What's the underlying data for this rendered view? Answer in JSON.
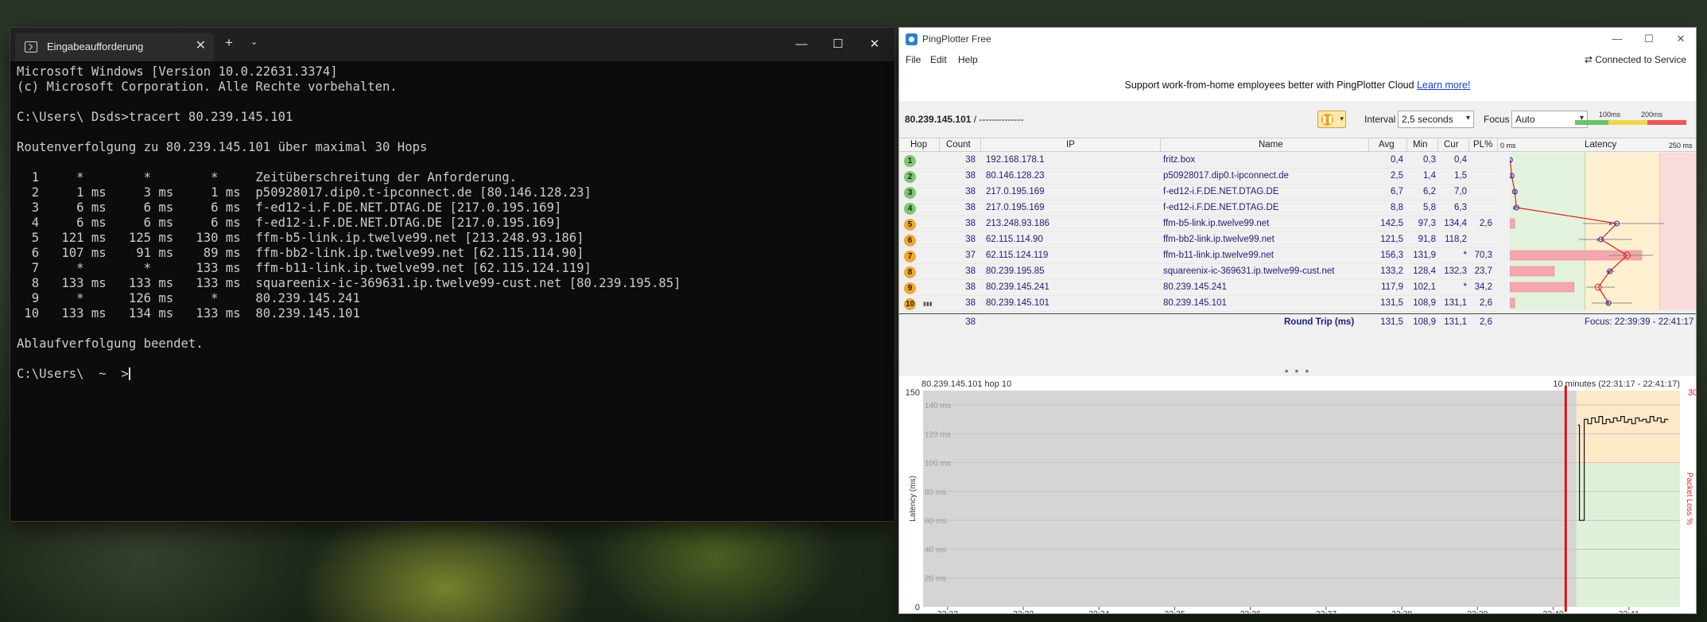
{
  "cmd": {
    "tab_title": "Eingabeaufforderung",
    "new_tab": "+",
    "lines": [
      "Microsoft Windows [Version 10.0.22631.3374]",
      "(c) Microsoft Corporation. Alle Rechte vorbehalten.",
      "",
      "C:\\Users\\ Dsds>tracert 80.239.145.101",
      "",
      "Routenverfolgung zu 80.239.145.101 über maximal 30 Hops",
      "",
      "  1     *        *        *     Zeitüberschreitung der Anforderung.",
      "  2     1 ms     3 ms     1 ms  p50928017.dip0.t-ipconnect.de [80.146.128.23]",
      "  3     6 ms     6 ms     6 ms  f-ed12-i.F.DE.NET.DTAG.DE [217.0.195.169]",
      "  4     6 ms     6 ms     6 ms  f-ed12-i.F.DE.NET.DTAG.DE [217.0.195.169]",
      "  5   121 ms   125 ms   130 ms  ffm-b5-link.ip.twelve99.net [213.248.93.186]",
      "  6   107 ms    91 ms    89 ms  ffm-bb2-link.ip.twelve99.net [62.115.114.90]",
      "  7     *        *      133 ms  ffm-b11-link.ip.twelve99.net [62.115.124.119]",
      "  8   133 ms   133 ms   133 ms  squareenix-ic-369631.ip.twelve99-cust.net [80.239.195.85]",
      "  9     *      126 ms     *     80.239.145.241",
      " 10   133 ms   134 ms   133 ms  80.239.145.101",
      "",
      "Ablaufverfolgung beendet.",
      "",
      "C:\\Users\\  ~  >"
    ]
  },
  "pingplotter": {
    "title": "PingPlotter Free",
    "menu": [
      "File",
      "Edit",
      "Help"
    ],
    "connection": "⇄ Connected to Service",
    "banner_text": "Support work-from-home employees better with PingPlotter Cloud",
    "banner_link": "Learn more!",
    "target": "80.239.145.101",
    "target_suffix": "/  --------------",
    "interval_label": "Interval",
    "interval_value": "2,5 seconds",
    "focus_label": "Focus",
    "focus_value": "Auto",
    "legend_100": "100ms",
    "legend_200": "200ms",
    "columns": {
      "hop": "Hop",
      "count": "Count",
      "ip": "IP",
      "name": "Name",
      "avg": "Avg",
      "min": "Min",
      "cur": "Cur",
      "pl": "PL%",
      "latency": "Latency",
      "scale_left": "0 ms",
      "scale_right": "250 ms"
    },
    "hops": [
      {
        "hop": "1",
        "count": "38",
        "ip": "192.168.178.1",
        "name": "fritz.box",
        "avg": "0,4",
        "min": "0,3",
        "cur": "0,4",
        "pl": "",
        "color": "#7cc870"
      },
      {
        "hop": "2",
        "count": "38",
        "ip": "80.146.128.23",
        "name": "p50928017.dip0.t-ipconnect.de",
        "avg": "2,5",
        "min": "1,4",
        "cur": "1,5",
        "pl": "",
        "color": "#7cc870"
      },
      {
        "hop": "3",
        "count": "38",
        "ip": "217.0.195.169",
        "name": "f-ed12-i.F.DE.NET.DTAG.DE",
        "avg": "6,7",
        "min": "6,2",
        "cur": "7,0",
        "pl": "",
        "color": "#7cc870"
      },
      {
        "hop": "4",
        "count": "38",
        "ip": "217.0.195.169",
        "name": "f-ed12-i.F.DE.NET.DTAG.DE",
        "avg": "8,8",
        "min": "5,8",
        "cur": "6,3",
        "pl": "",
        "color": "#7cc870"
      },
      {
        "hop": "5",
        "count": "38",
        "ip": "213.248.93.186",
        "name": "ffm-b5-link.ip.twelve99.net",
        "avg": "142,5",
        "min": "97,3",
        "cur": "134,4",
        "pl": "2,6",
        "color": "#f0a830"
      },
      {
        "hop": "6",
        "count": "38",
        "ip": "62.115.114.90",
        "name": "ffm-bb2-link.ip.twelve99.net",
        "avg": "121,5",
        "min": "91,8",
        "cur": "118,2",
        "pl": "",
        "color": "#f0a830"
      },
      {
        "hop": "7",
        "count": "37",
        "ip": "62.115.124.119",
        "name": "ffm-b11-link.ip.twelve99.net",
        "avg": "156,3",
        "min": "131,9",
        "cur": "*",
        "pl": "70,3",
        "color": "#f0a830"
      },
      {
        "hop": "8",
        "count": "38",
        "ip": "80.239.195.85",
        "name": "squareenix-ic-369631.ip.twelve99-cust.net",
        "avg": "133,2",
        "min": "128,4",
        "cur": "132,3",
        "pl": "23,7",
        "color": "#f0a830"
      },
      {
        "hop": "9",
        "count": "38",
        "ip": "80.239.145.241",
        "name": "80.239.145.241",
        "avg": "117,9",
        "min": "102,1",
        "cur": "*",
        "pl": "34,2",
        "color": "#f0a830"
      },
      {
        "hop": "10",
        "count": "38",
        "ip": "80.239.145.101",
        "name": "80.239.145.101",
        "avg": "131,5",
        "min": "108,9",
        "cur": "131,1",
        "pl": "2,6",
        "color": "#f0a830"
      }
    ],
    "totals": {
      "count": "38",
      "label": "Round Trip (ms)",
      "avg": "131,5",
      "min": "108,9",
      "cur": "131,1",
      "pl": "2,6",
      "focus": "Focus: 22:39:39 - 22:41:17"
    },
    "lower": {
      "host": "80.239.145.101 hop 10",
      "range": "10 minutes (22:31:17 - 22:41:17)",
      "y_top": "150",
      "y_bottom": "0",
      "right_top": "30",
      "ylabel": "Latency (ms)",
      "y2label": "Packet Loss %",
      "grid_labels": [
        "140 ms",
        "120 ms",
        "100 ms",
        "80 ms",
        "60 ms",
        "40 ms",
        "20 ms"
      ],
      "x_ticks": [
        "22:32",
        "22:33",
        "22:34",
        "22:35",
        "22:36",
        "22:37",
        "22:38",
        "22:39",
        "22:40",
        "22:41"
      ]
    }
  }
}
